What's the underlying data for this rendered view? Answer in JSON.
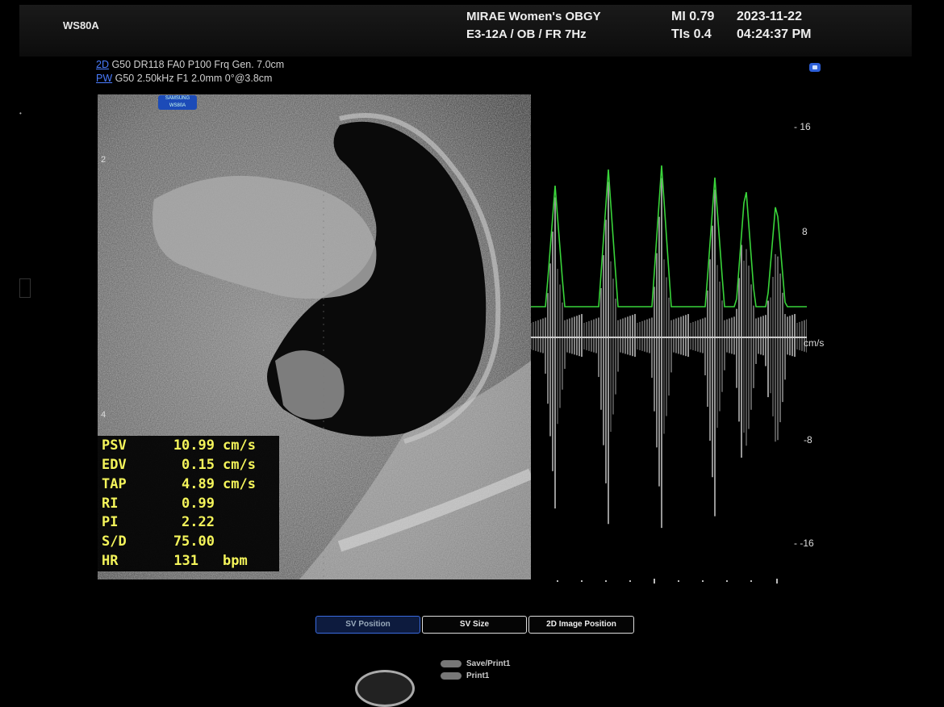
{
  "header": {
    "model": "WS80A",
    "hospital": "MIRAE Women's OBGY",
    "probe_line": "E3-12A / OB / FR 7Hz",
    "mi": "MI  0.79",
    "tis": "TIs 0.4",
    "date": "2023-11-22",
    "time": "04:24:37 PM"
  },
  "params": {
    "line1_tag": "2D",
    "line1": " G50 DR118 FA0 P100 Frq Gen. 7.0cm",
    "line2_tag": "PW",
    "line2": " G50 2.50kHz F1  2.0mm 0°@3.8cm"
  },
  "logo": {
    "line1": "SAMSUNG",
    "line2": "WS80A"
  },
  "bmode": {
    "depth_marks": [
      "2",
      "4"
    ]
  },
  "spectral": {
    "scale": [
      "16",
      "8",
      "-8",
      "-16"
    ],
    "unit": "cm/s"
  },
  "measurements": [
    {
      "label": "PSV",
      "value": "10.99",
      "unit": "cm/s"
    },
    {
      "label": "EDV",
      "value": "0.15",
      "unit": "cm/s"
    },
    {
      "label": "TAP",
      "value": "4.89",
      "unit": "cm/s"
    },
    {
      "label": "RI",
      "value": "0.99",
      "unit": ""
    },
    {
      "label": "PI",
      "value": "2.22",
      "unit": ""
    },
    {
      "label": "S/D",
      "value": "75.00",
      "unit": ""
    },
    {
      "label": "HR",
      "value": "131",
      "unit": "bpm"
    }
  ],
  "softkeys": [
    "SV Position",
    "SV Size",
    "2D Image Position"
  ],
  "save_print": {
    "save_label": "Save/Print1",
    "print_label": "Print1"
  },
  "colors": {
    "trace": "#39d43a",
    "meas_text": "#f4f45a",
    "accent": "#3a6be0"
  }
}
